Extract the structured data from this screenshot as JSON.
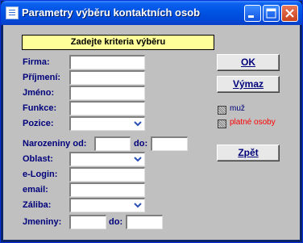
{
  "window": {
    "title": "Parametry výběru kontaktních osob"
  },
  "form": {
    "header": "Zadejte kriteria výběru",
    "labels": {
      "firma": "Firma:",
      "prijmeni": "Příjmení:",
      "jmeno": "Jméno:",
      "funkce": "Funkce:",
      "pozice": "Pozice:",
      "narozeniny_od": "Narozeniny od:",
      "narozeniny_do": "do:",
      "oblast": "Oblast:",
      "elogin": "e-Login:",
      "email": "email:",
      "zaliba": "Záliba:",
      "jmeniny": "Jmeniny:",
      "jmeniny_do": "do:"
    },
    "values": {
      "firma": "",
      "prijmeni": "",
      "jmeno": "",
      "funkce": "",
      "pozice": "",
      "narozeniny_od": "",
      "narozeniny_do": "",
      "oblast": "",
      "elogin": "",
      "email": "",
      "zaliba": "",
      "jmeniny_od": "",
      "jmeniny_do": ""
    }
  },
  "buttons": {
    "ok": "OK",
    "vymaz": "Výmaz",
    "zpet": "Zpět"
  },
  "checkboxes": [
    {
      "label": "muž",
      "color": "#00007b"
    },
    {
      "label": "platné osoby",
      "color": "#ff0000"
    }
  ],
  "colors": {
    "label": "#00007b",
    "header_bg": "#ffff99",
    "client_bg": "#c0c0c0",
    "titlebar": "#0054e3"
  }
}
